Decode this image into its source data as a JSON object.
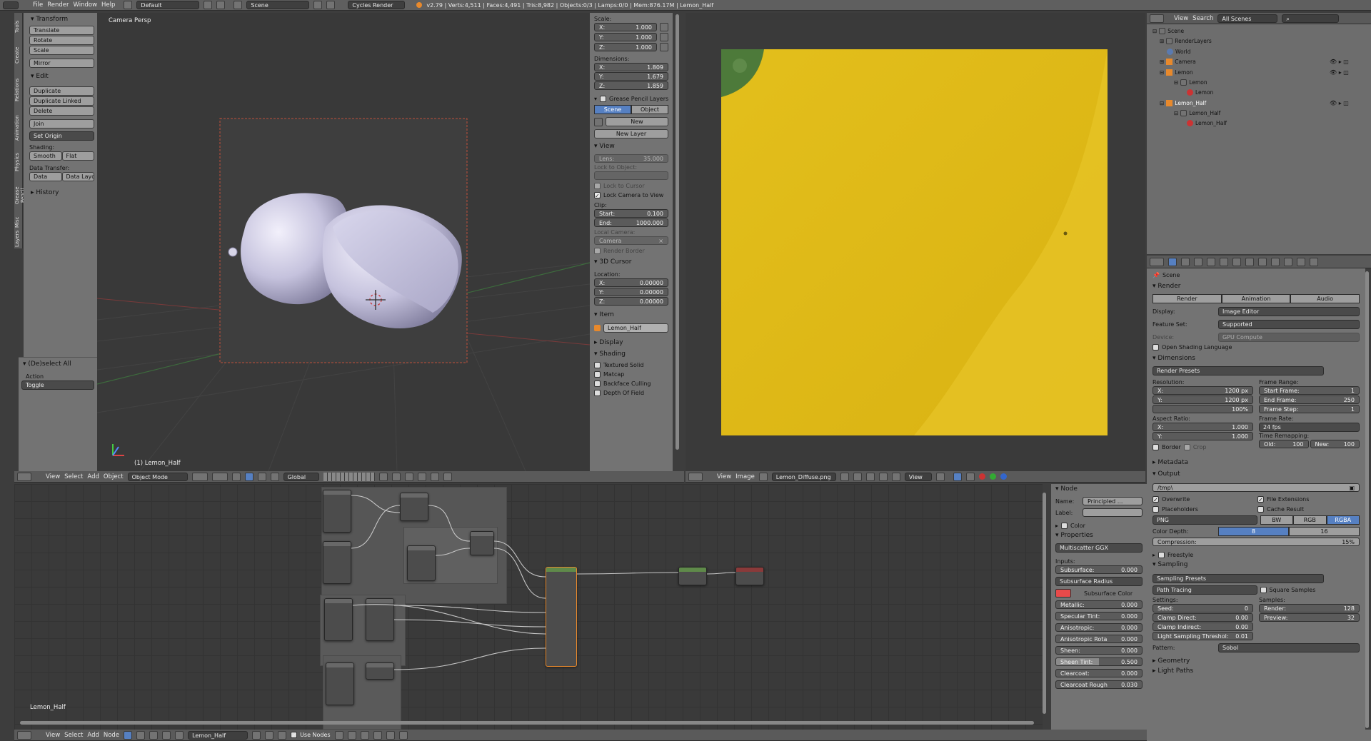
{
  "topbar": {
    "menus": [
      "File",
      "Render",
      "Window",
      "Help"
    ],
    "screen_layout": "Default",
    "scene": "Scene",
    "engine": "Cycles Render",
    "stats": "v2.79 | Verts:4,511 | Faces:4,491 | Tris:8,982 | Objects:0/3 | Lamps:0/0 | Mem:876.17M | Lemon_Half"
  },
  "side_tabs": [
    "Tools",
    "Create",
    "Relations",
    "Animation",
    "Physics",
    "Grease Pencil",
    "Misc",
    "Layers"
  ],
  "tools": {
    "transform": {
      "title": "Transform",
      "buttons": [
        "Translate",
        "Rotate",
        "Scale",
        "Mirror"
      ]
    },
    "edit": {
      "title": "Edit",
      "buttons": [
        "Duplicate",
        "Duplicate Linked",
        "Delete",
        "Join"
      ],
      "set_origin": "Set Origin",
      "shading_label": "Shading:",
      "smooth": "Smooth",
      "flat": "Flat",
      "data_transfer_label": "Data Transfer:",
      "data": "Data",
      "data_layout": "Data Layo"
    },
    "history": "History",
    "operator": {
      "title": "(De)select All",
      "action_label": "Action",
      "action_value": "Toggle"
    }
  },
  "viewport": {
    "label": "Camera Persp",
    "object_label": "(1) Lemon_Half"
  },
  "viewport_header": {
    "menus": [
      "View",
      "Select",
      "Add",
      "Object"
    ],
    "mode": "Object Mode",
    "orientation": "Global"
  },
  "properties_n": {
    "scale": {
      "title": "Scale:",
      "x": "1.000",
      "y": "1.000",
      "z": "1.000"
    },
    "dimensions": {
      "title": "Dimensions:",
      "x": "1.809",
      "y": "1.679",
      "z": "1.859"
    },
    "grease": {
      "title": "Grease Pencil Layers",
      "tab_scene": "Scene",
      "tab_object": "Object",
      "new": "New",
      "new_layer": "New Layer"
    },
    "view": {
      "title": "View",
      "lens_label": "Lens:",
      "lens": "35.000",
      "lock_to_object": "Lock to Object:",
      "lock_to_cursor": "Lock to Cursor",
      "lock_camera": "Lock Camera to View",
      "clip": "Clip:",
      "start_label": "Start:",
      "start": "0.100",
      "end_label": "End:",
      "end": "1000.000",
      "local_camera": "Local Camera:",
      "camera": "Camera",
      "render_border": "Render Border"
    },
    "cursor": {
      "title": "3D Cursor",
      "location": "Location:",
      "x": "0.00000",
      "y": "0.00000",
      "z": "0.00000"
    },
    "item": {
      "title": "Item",
      "name": "Lemon_Half"
    },
    "display": "Display",
    "shading": {
      "title": "Shading",
      "opts": [
        "Textured Solid",
        "Matcap",
        "Backface Culling",
        "Depth Of Field"
      ]
    }
  },
  "image_editor_header": {
    "menus": [
      "View",
      "Image"
    ],
    "image": "Lemon_Diffuse.png",
    "view": "View"
  },
  "outliner": {
    "menus": [
      "View",
      "Search"
    ],
    "filter": "All Scenes",
    "tree": [
      "Scene",
      "RenderLayers",
      "World",
      "Camera",
      "Lemon",
      "Lemon",
      "Lemon",
      "Lemon_Half",
      "Lemon_Half",
      "Lemon_Half"
    ]
  },
  "render_props": {
    "scene": "Scene",
    "render": {
      "title": "Render",
      "btn_render": "Render",
      "btn_anim": "Animation",
      "btn_audio": "Audio",
      "display_label": "Display:",
      "display": "Image Editor",
      "feature_label": "Feature Set:",
      "feature": "Supported",
      "device_label": "Device:",
      "device": "GPU Compute",
      "osl": "Open Shading Language"
    },
    "dimensions": {
      "title": "Dimensions",
      "presets": "Render Presets",
      "resolution": "Resolution:",
      "res_x": "1200 px",
      "res_y": "1200 px",
      "res_pct": "100%",
      "frame_range": "Frame Range:",
      "start_frame": "Start Frame:",
      "start_val": "1",
      "end_frame": "End Frame:",
      "end_val": "250",
      "frame_step": "Frame Step:",
      "step_val": "1",
      "aspect": "Aspect Ratio:",
      "asp_x": "1.000",
      "asp_y": "1.000",
      "frame_rate": "Frame Rate:",
      "fps": "24 fps",
      "time_remap": "Time Remapping:",
      "old": "Old:",
      "old_val": "100",
      "new": "New:",
      "new_val": "100",
      "border": "Border",
      "crop": "Crop"
    },
    "metadata": "Metadata",
    "output": {
      "title": "Output",
      "path": "/tmp\\",
      "overwrite": "Overwrite",
      "file_ext": "File Extensions",
      "placeholders": "Placeholders",
      "cache": "Cache Result",
      "format": "PNG",
      "bw": "BW",
      "rgb": "RGB",
      "rgba": "RGBA",
      "depth_label": "Color Depth:",
      "depth8": "8",
      "depth16": "16",
      "compression": "Compression:",
      "compression_val": "15%"
    },
    "freestyle": "Freestyle",
    "sampling": {
      "title": "Sampling",
      "presets": "Sampling Presets",
      "method": "Path Tracing",
      "square": "Square Samples",
      "settings": "Settings:",
      "seed_label": "Seed:",
      "seed": "0",
      "clamp_direct": "Clamp Direct:",
      "cd_val": "0.00",
      "clamp_indirect": "Clamp Indirect:",
      "ci_val": "0.00",
      "light_thresh": "Light Sampling Threshol:",
      "lt_val": "0.01",
      "samples": "Samples:",
      "render_label": "Render:",
      "render_val": "128",
      "preview_label": "Preview:",
      "preview_val": "32",
      "pattern_label": "Pattern:",
      "pattern": "Sobol"
    },
    "geometry": "Geometry",
    "light_paths": "Light Paths"
  },
  "node_panel": {
    "node_title": "Node",
    "name_label": "Name:",
    "name": "Principled ...",
    "label_label": "Label:",
    "color": "Color",
    "properties": "Properties",
    "distribution": "Multiscatter GGX",
    "inputs": "Inputs:",
    "subsurface_label": "Subsurface:",
    "subsurface": "0.000",
    "ss_radius": "Subsurface Radius",
    "ss_color": "Subsurface Color",
    "metallic_label": "Metallic:",
    "metallic": "0.000",
    "specular_tint_label": "Specular Tint:",
    "specular_tint": "0.000",
    "anisotropic_label": "Anisotropic:",
    "anisotropic": "0.000",
    "aniso_rot_label": "Anisotropic Rota",
    "aniso_rot": "0.000",
    "sheen_label": "Sheen:",
    "sheen": "0.000",
    "sheen_tint_label": "Sheen Tint:",
    "sheen_tint": "0.500",
    "clearcoat_label": "Clearcoat:",
    "clearcoat": "0.000",
    "clearcoat_rough_label": "Clearcoat Rough",
    "clearcoat_rough": "0.030"
  },
  "node_editor": {
    "material_label": "Lemon_Half"
  },
  "node_header": {
    "menus": [
      "View",
      "Select",
      "Add",
      "Node"
    ],
    "material": "Lemon_Half",
    "use_nodes": "Use Nodes"
  },
  "colors": {
    "accent": "#5680c2",
    "lemon": "#e0bb18",
    "subsurface_color": "#e84a4a"
  }
}
